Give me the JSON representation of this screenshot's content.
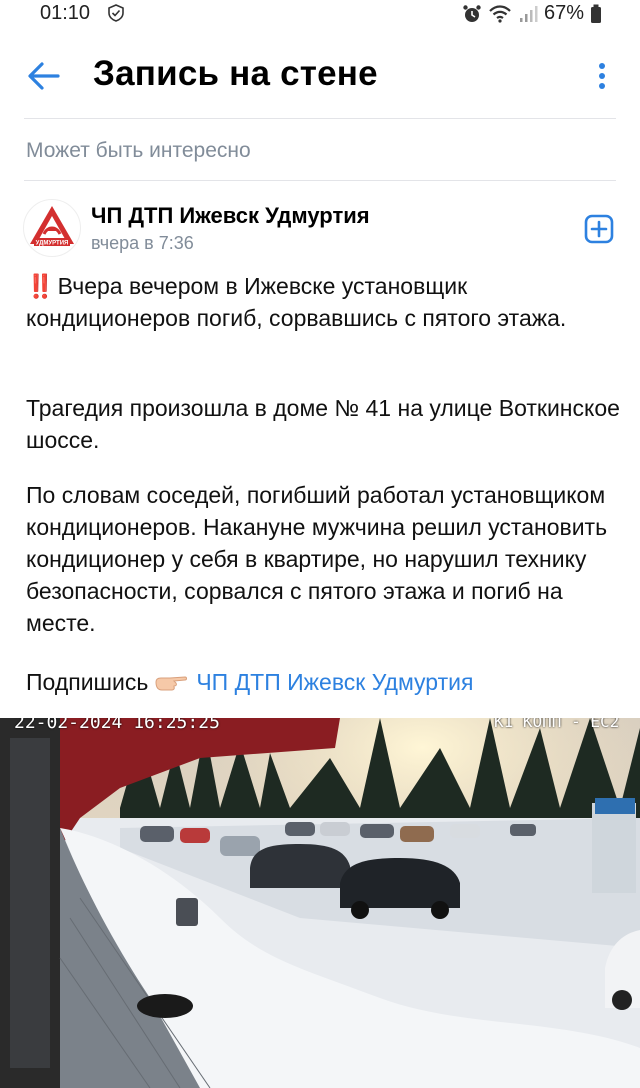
{
  "status_bar": {
    "time": "01:10",
    "battery": "67%"
  },
  "header": {
    "title": "Запись на стене"
  },
  "section": {
    "title": "Может быть интересно"
  },
  "post": {
    "author": "ЧП ДТП Ижевск Удмуртия",
    "time": "вчера в 7:36",
    "avatar_text": "УДМУРТИЯ",
    "emoji": "‼️",
    "paragraph1": "Вчера вечером в Ижевске установщик кондиционеров погиб, сорвавшись с пятого этажа.",
    "paragraph2": "Трагедия произошла в доме № 41 на улице Воткинское шоссе.",
    "paragraph3": "По словам соседей, погибший работал установщиком кондиционеров. Накануне мужчина решил установить кондиционер у себя в квартире, но нарушил технику безопасности, сорвался с пятого этажа и погиб на месте.",
    "subscribe_prefix": "Подпишись",
    "subscribe_link": "ЧП ДТП Ижевск Удмуртия"
  },
  "photo": {
    "timestamp": "22-02-2024 16:25:25",
    "camera_label": "К1 КОПП - ЕС2"
  },
  "colors": {
    "accent": "#2d81e0",
    "secondary_text": "#818c99"
  }
}
